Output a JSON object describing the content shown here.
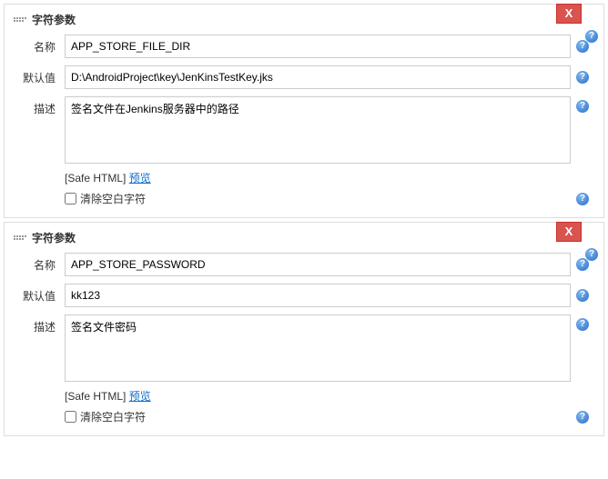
{
  "parameters": [
    {
      "section_title": "字符参数",
      "close_label": "X",
      "name_label": "名称",
      "name_value": "APP_STORE_FILE_DIR",
      "default_label": "默认值",
      "default_value": "D:\\AndroidProject\\key\\JenKinsTestKey.jks",
      "desc_label": "描述",
      "desc_value": "签名文件在Jenkins服务器中的路径",
      "safe_html_label": "[Safe HTML]",
      "preview_label": "预览",
      "trim_label": "清除空白字符",
      "trim_checked": false
    },
    {
      "section_title": "字符参数",
      "close_label": "X",
      "name_label": "名称",
      "name_value": "APP_STORE_PASSWORD",
      "default_label": "默认值",
      "default_value": "kk123",
      "desc_label": "描述",
      "desc_value": "签名文件密码",
      "safe_html_label": "[Safe HTML]",
      "preview_label": "预览",
      "trim_label": "清除空白字符",
      "trim_checked": false
    }
  ],
  "help_glyph": "?"
}
